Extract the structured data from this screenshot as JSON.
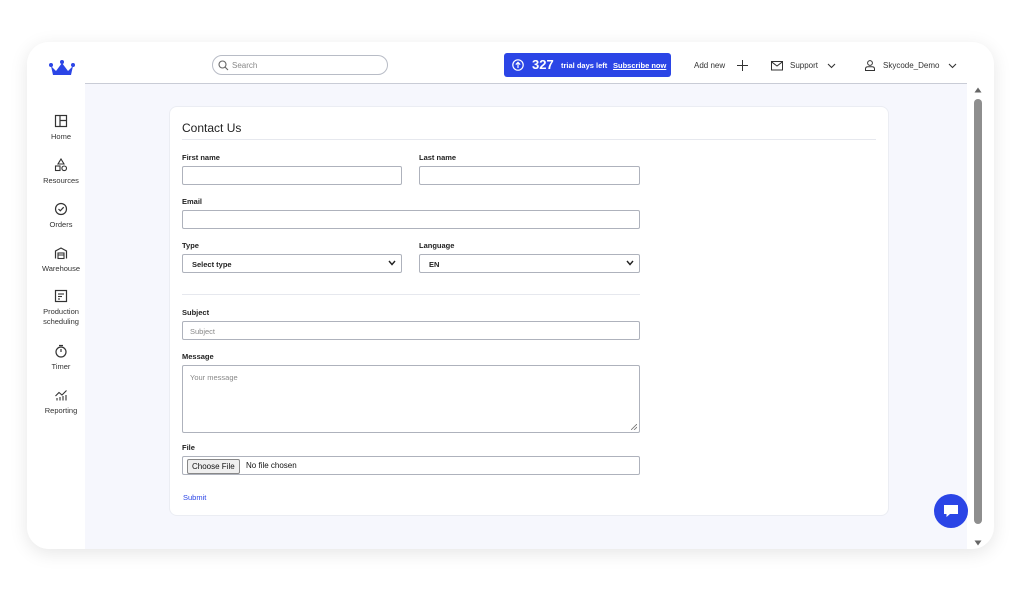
{
  "header": {
    "search_placeholder": "Search",
    "trial_count": "327",
    "trial_text": "trial days left",
    "subscribe_label": "Subscribe now",
    "add_new_label": "Add new",
    "support_label": "Support",
    "user_label": "Skycode_Demo"
  },
  "sidebar": {
    "items": [
      {
        "label": "Home",
        "icon": "home-icon"
      },
      {
        "label": "Resources",
        "icon": "resources-icon"
      },
      {
        "label": "Orders",
        "icon": "orders-icon"
      },
      {
        "label": "Warehouse",
        "icon": "warehouse-icon"
      },
      {
        "label": "Production scheduling",
        "icon": "production-icon"
      },
      {
        "label": "Timer",
        "icon": "timer-icon"
      },
      {
        "label": "Reporting",
        "icon": "reporting-icon"
      }
    ]
  },
  "form": {
    "title": "Contact Us",
    "first_name_label": "First name",
    "last_name_label": "Last name",
    "email_label": "Email",
    "type_label": "Type",
    "type_value": "Select type",
    "language_label": "Language",
    "language_value": "EN",
    "subject_label": "Subject",
    "subject_placeholder": "Subject",
    "message_label": "Message",
    "message_placeholder": "Your message",
    "file_label": "File",
    "file_button": "Choose File",
    "file_status": "No file chosen",
    "submit_label": "Submit"
  },
  "colors": {
    "accent": "#2b45e6",
    "background": "#f6f7fd"
  }
}
